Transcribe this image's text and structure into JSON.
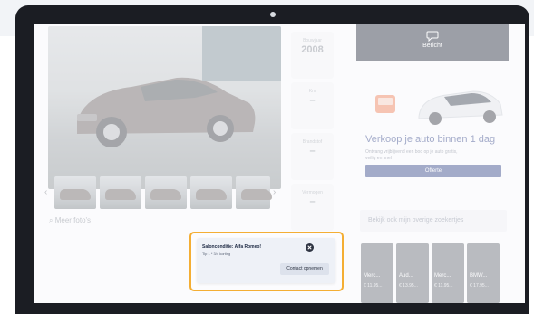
{
  "gallery": {
    "more_photos": "Meer foto's"
  },
  "specs": [
    {
      "label": "Bouwjaar",
      "value": "2008"
    },
    {
      "label": "Km",
      "value": "–"
    },
    {
      "label": "Brandstof",
      "value": "–"
    },
    {
      "label": "Vermogen",
      "value": "–"
    }
  ],
  "sidebar": {
    "message_label": "Bericht",
    "ad": {
      "title": "Verkoop je auto binnen 1 dag",
      "body": "Ontvang vrijblijvend een bod op je auto gratis, veilig en snel",
      "button": "Offerte"
    },
    "other_ads": "Bekijk ook mijn overige zoekertjes",
    "mini_cards": [
      {
        "name": "Merc...",
        "price": "€ 11.95..."
      },
      {
        "name": "Aud...",
        "price": "€ 13.95..."
      },
      {
        "name": "Merc...",
        "price": "€ 11.95..."
      },
      {
        "name": "BMW...",
        "price": "€ 17.95..."
      }
    ]
  },
  "popup": {
    "title": "Salonconditie: Alfa Romeo!",
    "subtitle": "Tip 1 * 3/4 korting",
    "button": "Contact opnemen"
  },
  "colors": {
    "highlight": "#f4ae34",
    "brand_dark": "#2a3140",
    "ad_blue": "#3a4b8c"
  },
  "icons": {
    "message": "speech-bubble-icon",
    "close": "close-icon",
    "arrow_left": "chevron-left-icon",
    "arrow_right": "chevron-right-icon"
  }
}
